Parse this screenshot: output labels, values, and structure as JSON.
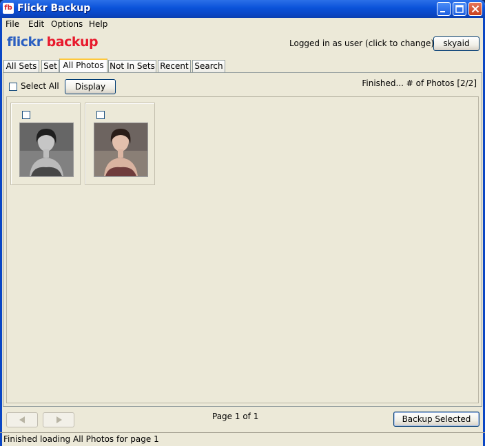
{
  "window": {
    "title": "Flickr Backup",
    "app_icon_text": "fb"
  },
  "menu": [
    {
      "label": "File"
    },
    {
      "label": "Edit"
    },
    {
      "label": "Options"
    },
    {
      "label": "Help"
    }
  ],
  "logo": {
    "part1": "flickr",
    "part2": " backup"
  },
  "login": {
    "text": "Logged in as user (click to change)",
    "username": "skyaid"
  },
  "tabs": [
    {
      "label": "All Sets"
    },
    {
      "label": "Set"
    },
    {
      "label": "All Photos",
      "active": true
    },
    {
      "label": "Not In Sets"
    },
    {
      "label": "Recent"
    },
    {
      "label": "Search"
    }
  ],
  "toolbar": {
    "select_all_label": "Select All",
    "display_label": "Display",
    "status": "Finished... # of Photos [2/2]"
  },
  "photos": [
    {
      "style": "grayscale",
      "checked": false
    },
    {
      "style": "color",
      "checked": false
    }
  ],
  "footer": {
    "page_label": "Page 1 of 1",
    "backup_label": "Backup Selected"
  },
  "statusbar": {
    "text": "Finished loading All Photos for page 1"
  },
  "colors": {
    "title_bar": "#0a52d9",
    "window_bg": "#ece9d8",
    "active_tab_accent": "#ffc83c"
  }
}
